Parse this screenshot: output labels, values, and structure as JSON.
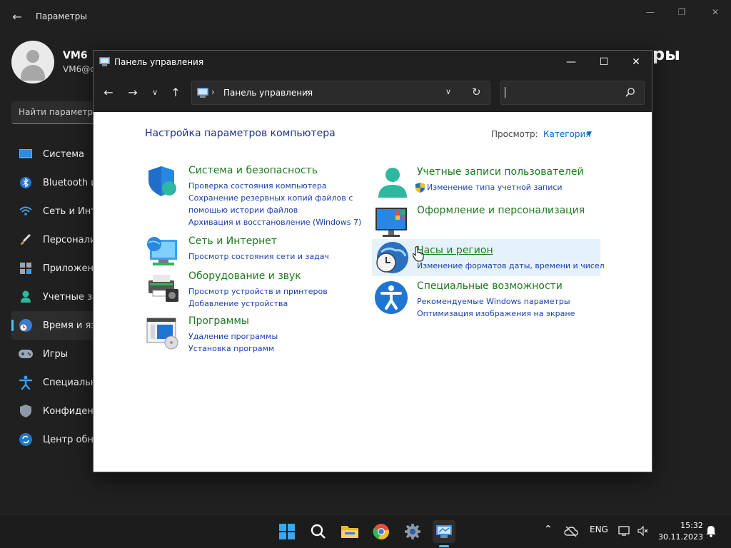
{
  "settings": {
    "title": "Параметры",
    "user_name": "VM6",
    "user_email": "VM6@c",
    "heading_fragment": "ры",
    "search_placeholder": "Найти параметр",
    "nav": [
      {
        "label": "Система",
        "icon": "monitor-icon"
      },
      {
        "label": "Bluetooth и",
        "icon": "bluetooth-icon"
      },
      {
        "label": "Сеть и Инт",
        "icon": "wifi-icon"
      },
      {
        "label": "Персонали",
        "icon": "brush-icon"
      },
      {
        "label": "Приложен",
        "icon": "apps-icon"
      },
      {
        "label": "Учетные за",
        "icon": "person-icon"
      },
      {
        "label": "Время и яз",
        "icon": "globe-clock-icon",
        "active": true
      },
      {
        "label": "Игры",
        "icon": "gamepad-icon"
      },
      {
        "label": "Специальн",
        "icon": "accessibility-icon"
      },
      {
        "label": "Конфиден",
        "icon": "shield-icon"
      },
      {
        "label": "Центр обн",
        "icon": "update-icon"
      }
    ]
  },
  "control_panel": {
    "title": "Панель управления",
    "address_path": "Панель управления",
    "search_value": "",
    "heading": "Настройка параметров компьютера",
    "view_label": "Просмотр:",
    "view_value": "Категория",
    "categories_left": [
      {
        "title": "Система и безопасность",
        "icon": "shield-security-icon",
        "links": [
          "Проверка состояния компьютера",
          "Сохранение резервных копий файлов с",
          "помощью истории файлов",
          "Архивация и восстановление (Windows 7)"
        ]
      },
      {
        "title": "Сеть и Интернет",
        "icon": "network-globe-icon",
        "links": [
          "Просмотр состояния сети и задач"
        ]
      },
      {
        "title": "Оборудование и звук",
        "icon": "printer-icon",
        "links": [
          "Просмотр устройств и принтеров",
          "Добавление устройства"
        ]
      },
      {
        "title": "Программы",
        "icon": "programs-icon",
        "links": [
          "Удаление программы",
          "Установка программ"
        ]
      }
    ],
    "categories_right": [
      {
        "title": "Учетные записи пользователей",
        "icon": "users-icon",
        "links": [
          "Изменение типа учетной записи"
        ]
      },
      {
        "title": "Оформление и персонализация",
        "icon": "display-icon",
        "links": []
      },
      {
        "title": "Часы и регион",
        "icon": "clock-globe-icon",
        "links": [
          "Изменение форматов даты, времени и чисел"
        ],
        "hovered": true
      },
      {
        "title": "Специальные возможности",
        "icon": "accessibility-icon",
        "links": [
          "Рекомендуемые Windows параметры",
          "Оптимизация изображения на экране"
        ]
      }
    ]
  },
  "taskbar": {
    "apps": [
      "start-icon",
      "search-icon",
      "explorer-icon",
      "chrome-icon",
      "settings-icon",
      "control-panel-icon"
    ],
    "tray": {
      "language": "ENG",
      "time": "15:32",
      "date": "30.11.2023"
    }
  },
  "colors": {
    "accent": "#4cc2ff",
    "category_title": "#1f7a1f",
    "link": "#1a3fb0",
    "heading": "#1e3287"
  }
}
